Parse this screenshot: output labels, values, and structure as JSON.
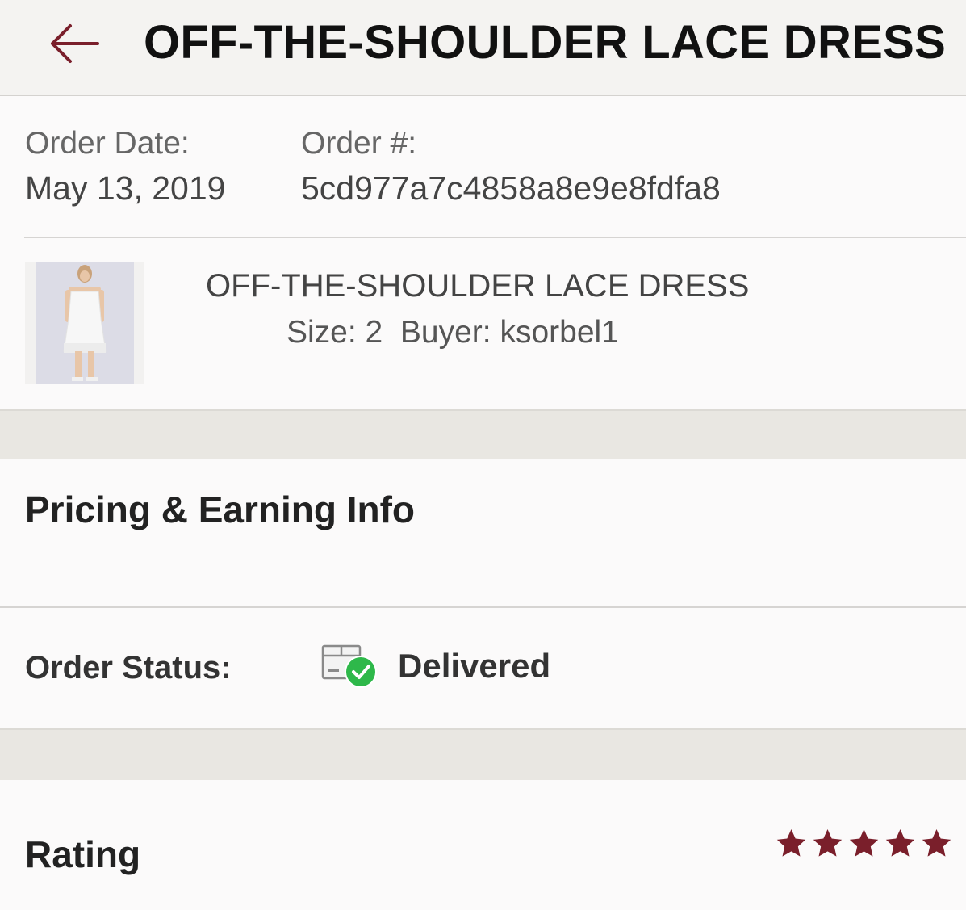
{
  "header": {
    "title": "OFF-THE-SHOULDER LACE DRESS",
    "back_icon": "arrow-left-icon",
    "accent_color": "#7a1f2b"
  },
  "order": {
    "date_label": "Order Date:",
    "date_value": "May 13, 2019",
    "number_label": "Order #:",
    "number_value": "5cd977a7c4858a8e9e8fdfa8"
  },
  "item": {
    "name": "OFF-THE-SHOULDER LACE DRESS",
    "size": "Size: 2",
    "buyer": "Buyer: ksorbel1"
  },
  "pricing": {
    "title": "Pricing & Earning Info"
  },
  "status": {
    "label": "Order Status:",
    "value": "Delivered",
    "icon": "package-delivered-icon",
    "check_color": "#2eb84a"
  },
  "rating": {
    "title": "Rating",
    "stars": 5,
    "max_stars": 5,
    "star_color": "#7a1f2b"
  }
}
